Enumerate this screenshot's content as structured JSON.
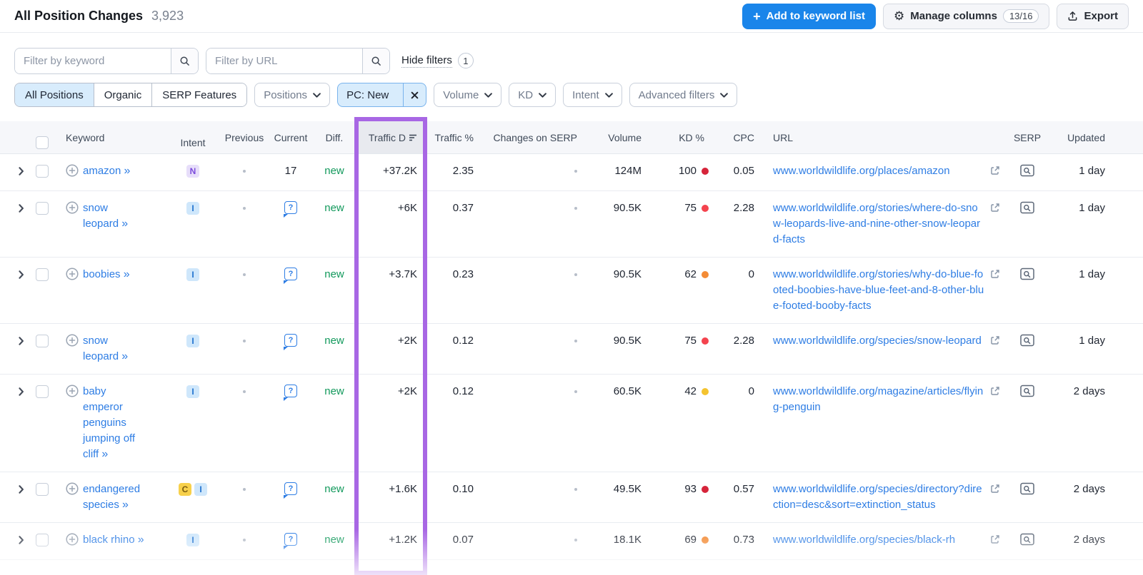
{
  "header": {
    "title": "All Position Changes",
    "count": "3,923",
    "add_button": "Add to keyword list",
    "manage_columns": "Manage columns",
    "columns_badge": "13/16",
    "export_label": "Export"
  },
  "filters": {
    "keyword_placeholder": "Filter by keyword",
    "url_placeholder": "Filter by URL",
    "hide_filters_label": "Hide filters",
    "active_filters_count": "1",
    "position_tabs": [
      "All Positions",
      "Organic",
      "SERP Features"
    ],
    "selected_tab": "All Positions",
    "chips": [
      {
        "label": "Positions",
        "kind": "dropdown"
      },
      {
        "label": "PC: New",
        "kind": "active"
      },
      {
        "label": "Volume",
        "kind": "dropdown"
      },
      {
        "label": "KD",
        "kind": "dropdown"
      },
      {
        "label": "Intent",
        "kind": "dropdown"
      },
      {
        "label": "Advanced filters",
        "kind": "dropdown"
      }
    ]
  },
  "table": {
    "columns": {
      "keyword": "Keyword",
      "intent": "Intent",
      "previous": "Previous",
      "current": "Current",
      "diff": "Diff.",
      "traffic_diff": "Traffic D",
      "traffic_pct": "Traffic %",
      "changes": "Changes on SERP",
      "volume": "Volume",
      "kd": "KD %",
      "cpc": "CPC",
      "url": "URL",
      "serp": "SERP",
      "updated": "Updated"
    },
    "sort": {
      "column": "Traffic Diff",
      "direction": "desc"
    },
    "rows": [
      {
        "keyword": "amazon",
        "intents": [
          "N"
        ],
        "previous": "•",
        "current": "17",
        "current_is_icon": false,
        "diff": "new",
        "traffic_diff": "+37.2K",
        "traffic_pct": "2.35",
        "changes_on_serp": "•",
        "volume": "124M",
        "kd": "100",
        "kd_color": "#d6243a",
        "cpc": "0.05",
        "url": "www.worldwildlife.org/places/amazon",
        "updated": "1 day"
      },
      {
        "keyword": "snow leopard",
        "intents": [
          "I"
        ],
        "previous": "•",
        "current": "",
        "current_is_icon": true,
        "diff": "new",
        "traffic_diff": "+6K",
        "traffic_pct": "0.37",
        "changes_on_serp": "•",
        "volume": "90.5K",
        "kd": "75",
        "kd_color": "#f4434e",
        "cpc": "2.28",
        "url": "www.worldwildlife.org/stories/where-do-snow-leopards-live-and-nine-other-snow-leopard-facts",
        "updated": "1 day"
      },
      {
        "keyword": "boobies",
        "intents": [
          "I"
        ],
        "previous": "•",
        "current": "",
        "current_is_icon": true,
        "diff": "new",
        "traffic_diff": "+3.7K",
        "traffic_pct": "0.23",
        "changes_on_serp": "•",
        "volume": "90.5K",
        "kd": "62",
        "kd_color": "#f38b36",
        "cpc": "0",
        "url": "www.worldwildlife.org/stories/why-do-blue-footed-boobies-have-blue-feet-and-8-other-blue-footed-booby-facts",
        "updated": "1 day"
      },
      {
        "keyword": "snow leopard",
        "intents": [
          "I"
        ],
        "previous": "•",
        "current": "",
        "current_is_icon": true,
        "diff": "new",
        "traffic_diff": "+2K",
        "traffic_pct": "0.12",
        "changes_on_serp": "•",
        "volume": "90.5K",
        "kd": "75",
        "kd_color": "#f4434e",
        "cpc": "2.28",
        "url": "www.worldwildlife.org/species/snow-leopard",
        "updated": "1 day"
      },
      {
        "keyword": "baby emperor penguins jumping off cliff",
        "intents": [
          "I"
        ],
        "previous": "•",
        "current": "",
        "current_is_icon": true,
        "diff": "new",
        "traffic_diff": "+2K",
        "traffic_pct": "0.12",
        "changes_on_serp": "•",
        "volume": "60.5K",
        "kd": "42",
        "kd_color": "#f4c32f",
        "cpc": "0",
        "url": "www.worldwildlife.org/magazine/articles/flying-penguin",
        "updated": "2 days"
      },
      {
        "keyword": "endangered species",
        "intents": [
          "C",
          "I"
        ],
        "previous": "•",
        "current": "",
        "current_is_icon": true,
        "diff": "new",
        "traffic_diff": "+1.6K",
        "traffic_pct": "0.10",
        "changes_on_serp": "•",
        "volume": "49.5K",
        "kd": "93",
        "kd_color": "#d6243a",
        "cpc": "0.57",
        "url": "www.worldwildlife.org/species/directory?direction=desc&sort=extinction_status",
        "updated": "2 days"
      },
      {
        "keyword": "black rhino",
        "intents": [
          "I"
        ],
        "previous": "•",
        "current": "",
        "current_is_icon": true,
        "diff": "new",
        "traffic_diff": "+1.2K",
        "traffic_pct": "0.07",
        "changes_on_serp": "•",
        "volume": "18.1K",
        "kd": "69",
        "kd_color": "#f38b36",
        "cpc": "0.73",
        "url": "www.worldwildlife.org/species/black-rh",
        "updated": "2 days"
      }
    ]
  },
  "colors": {
    "primary_button": "#1a85ea",
    "link": "#2e7de4",
    "new_green": "#12995c",
    "highlight_purple": "#a867e4",
    "selected_chip_bg": "#d8ecfc"
  }
}
